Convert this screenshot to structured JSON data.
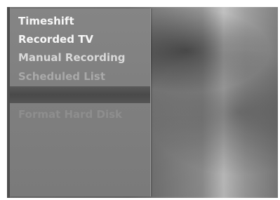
{
  "menu": {
    "items": [
      {
        "label": "Timeshift"
      },
      {
        "label": "Recorded TV"
      },
      {
        "label": "Manual Recording"
      },
      {
        "label": "Scheduled List"
      },
      {
        "label": ""
      },
      {
        "label": "Format Hard Disk"
      }
    ]
  }
}
